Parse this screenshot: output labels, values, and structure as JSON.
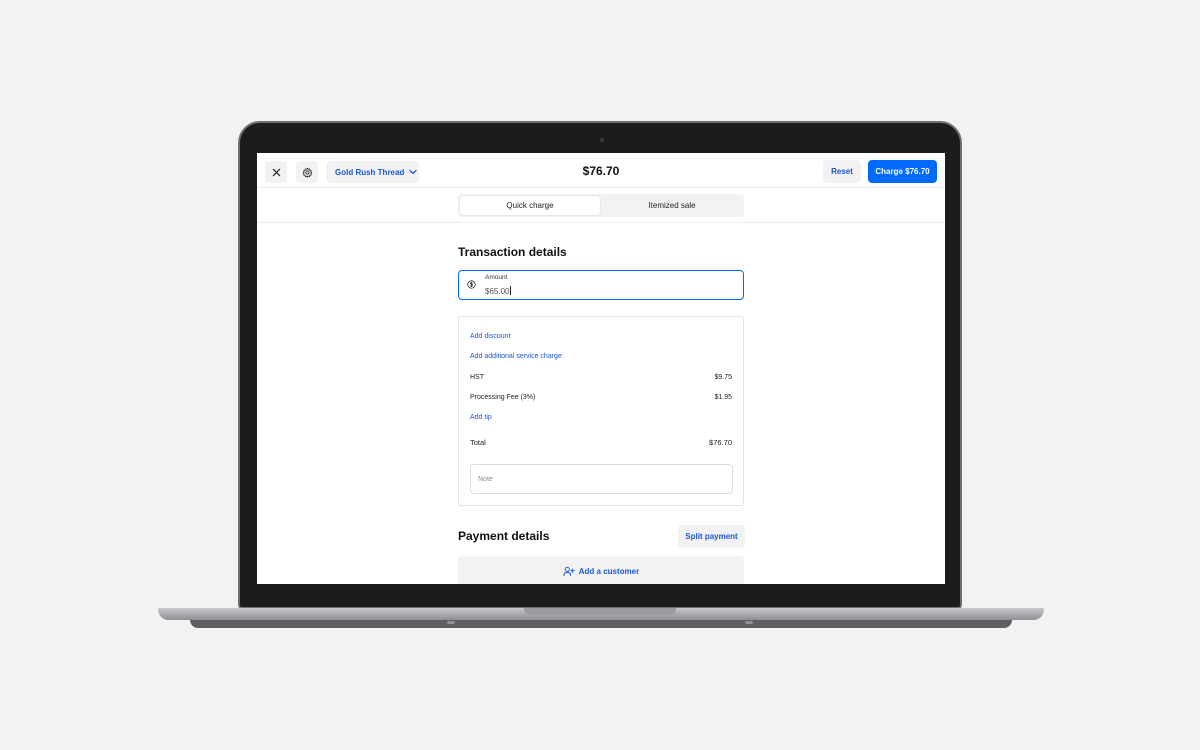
{
  "topbar": {
    "close_icon": "close-icon",
    "settings_icon": "gear-icon",
    "location_label": "Gold Rush Thread",
    "total": "$76.70",
    "reset_label": "Reset",
    "charge_label": "Charge $76.70"
  },
  "tabs": [
    {
      "label": "Quick charge",
      "active": true
    },
    {
      "label": "Itemized sale",
      "active": false
    }
  ],
  "transaction": {
    "title": "Transaction details",
    "amount_label": "Amount",
    "amount_value": "$65.00"
  },
  "summary": {
    "add_discount": "Add discount",
    "add_service_charge": "Add additional service charge",
    "hst_label": "HST",
    "hst_value": "$9.75",
    "fee_label": "Processing Fee (3%)",
    "fee_value": "$1.95",
    "add_tip": "Add tip",
    "total_label": "Total",
    "total_value": "$76.70",
    "note_placeholder": "Note"
  },
  "payment": {
    "title": "Payment details",
    "split_label": "Split payment",
    "add_customer_label": "Add a customer"
  },
  "colors": {
    "accent": "#006aff",
    "link": "#1a56d6",
    "surface": "#f2f2f2"
  }
}
